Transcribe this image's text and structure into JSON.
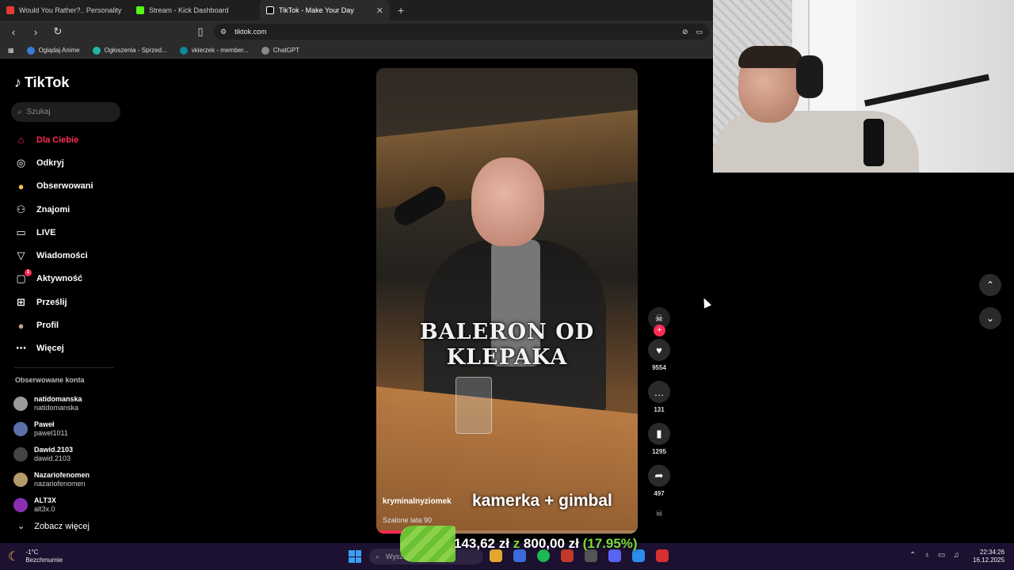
{
  "browser": {
    "tabs": [
      {
        "title": "Would You Rather?.. Personality Qui",
        "color": "#e53935"
      },
      {
        "title": "Stream - Kick Dashboard",
        "color": "#53fc18"
      },
      {
        "title": "TikTok - Make Your Day",
        "color": "#ffffff"
      }
    ],
    "url": "tiktok.com",
    "bookmarks": [
      "Oglądaj Anime",
      "Ogłoszenia - Sprzed...",
      "vkierzek - member...",
      "ChatGPT"
    ]
  },
  "tiktok": {
    "logo": "TikTok",
    "search_placeholder": "Szukaj",
    "nav": [
      {
        "label": "Dla Ciebie",
        "icon": "home-icon",
        "glyph": "⌂"
      },
      {
        "label": "Odkryj",
        "icon": "compass-icon",
        "glyph": "◎"
      },
      {
        "label": "Obserwowani",
        "icon": "following-icon",
        "glyph": "●"
      },
      {
        "label": "Znajomi",
        "icon": "friends-icon",
        "glyph": "⚇"
      },
      {
        "label": "LIVE",
        "icon": "live-icon",
        "glyph": "▭"
      },
      {
        "label": "Wiadomości",
        "icon": "messages-icon",
        "glyph": "▽"
      },
      {
        "label": "Aktywność",
        "icon": "activity-icon",
        "glyph": "▢"
      },
      {
        "label": "Prześlij",
        "icon": "upload-icon",
        "glyph": "⊞"
      },
      {
        "label": "Profil",
        "icon": "profile-icon",
        "glyph": "●"
      },
      {
        "label": "Więcej",
        "icon": "more-icon",
        "glyph": "⋯"
      }
    ],
    "activity_badge": "1",
    "followed_heading": "Obserwowane konta",
    "accounts": [
      {
        "name": "natidomanska",
        "user": "natidomanska",
        "color": "#9a9a9a"
      },
      {
        "name": "Paweł",
        "user": "pawel1011",
        "color": "#5b6fa8"
      },
      {
        "name": "Dawid.2103",
        "user": "dawid.2103",
        "color": "#444444"
      },
      {
        "name": "Nazariofenomen",
        "user": "nazariofenomen",
        "color": "#b59a6a"
      },
      {
        "name": "ALT3X",
        "user": "alt3x.0",
        "color": "#8a2fb3"
      }
    ],
    "see_more": "Zobacz więcej",
    "video": {
      "caption": "BALERON OD KLEPAKA",
      "author": "kryminalnyziomek",
      "description": "Szalone lata 90",
      "progress": 0.1
    },
    "actions": {
      "likes": "9554",
      "comments": "131",
      "saves": "1295",
      "shares": "497"
    }
  },
  "stream_overlay": "kamerka + gimbal",
  "donation": {
    "amount": "143,62 zł",
    "sep": "z",
    "goal": "800,00 zł",
    "percent": "(17.95%)"
  },
  "taskbar": {
    "temperature": "-1°C",
    "weather": "Bezchmurnie",
    "search": "Wyszukaj",
    "time": "22:34:26",
    "date": "16.12.2025"
  }
}
